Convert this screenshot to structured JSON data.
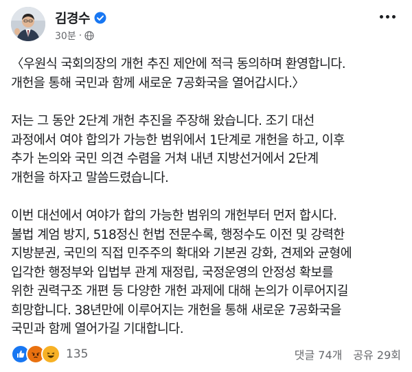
{
  "author": {
    "name": "김경수",
    "time": "30분"
  },
  "post": {
    "paragraphs": [
      "〈우원식 국회의장의 개헌 추진 제안에 적극 동의하며 환영합니다.\n개헌을 통해 국민과 함께 새로운 7공화국을 열어갑시다.〉",
      "저는 그 동안 2단계 개헌 추진을 주장해 왔습니다. 조기 대선\n과정에서 여야 합의가 가능한 범위에서 1단계로 개헌을 하고, 이후\n추가 논의와 국민 의견 수렴을 거쳐 내년 지방선거에서 2단계\n개헌을 하자고 말씀드렸습니다.",
      "이번 대선에서 여야가 합의 가능한 범위의 개헌부터 먼저 합시다.\n불법 계엄 방지, 518정신 헌법 전문수록, 행정수도 이전 및 강력한\n지방분권, 국민의 직접 민주주의 확대와 기본권 강화, 견제와 균형에\n입각한 행정부와 입법부 관계 재정립, 국정운영의 안정성 확보를\n위한 권력구조 개편 등 다양한 개헌 과제에 대해 논의가 이루어지길\n희망합니다. 38년만에 이루어지는 개헌을 통해 새로운 7공화국을\n국민과 함께 열어가길 기대합니다."
    ]
  },
  "footer": {
    "reaction_count": "135",
    "comments": "댓글 74개",
    "shares": "공유 29회"
  },
  "colors": {
    "like": "#1877f2",
    "angry": "#e9710f",
    "haha": "#f7b125"
  }
}
